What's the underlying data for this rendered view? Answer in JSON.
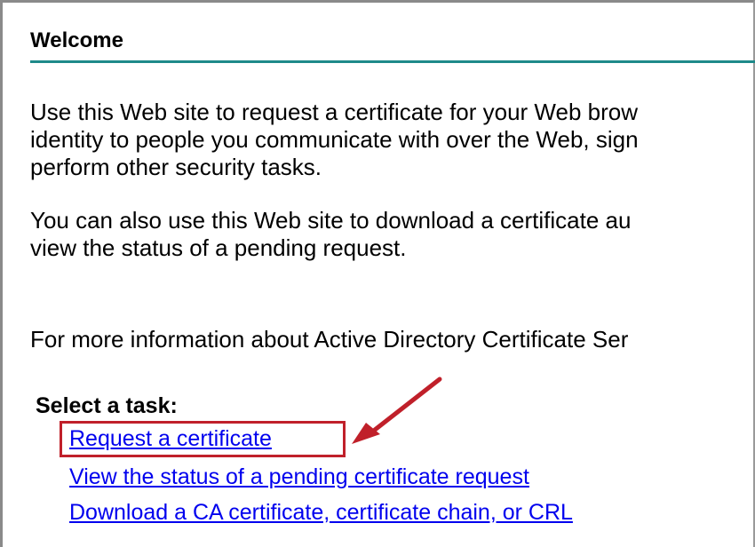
{
  "welcome": {
    "title": "Welcome",
    "accent_color": "#1e8a8a"
  },
  "intro": {
    "paragraph1": [
      "Use this Web site to request a certificate for your Web brow",
      "identity to people you communicate with over the Web, sign",
      "perform other security tasks."
    ],
    "paragraph2": [
      "You can also use this Web site to download a certificate au",
      "view the status of a pending request."
    ],
    "paragraph3": [
      "For more information about Active Directory Certificate Ser"
    ]
  },
  "tasks": {
    "heading": "Select a task:",
    "links": [
      {
        "label": "Request a certificate"
      },
      {
        "label": "View the status of a pending certificate request"
      },
      {
        "label": "Download a CA certificate, certificate chain, or CRL"
      }
    ],
    "link_color": "#0000ee",
    "highlight_color": "#c0202a"
  }
}
